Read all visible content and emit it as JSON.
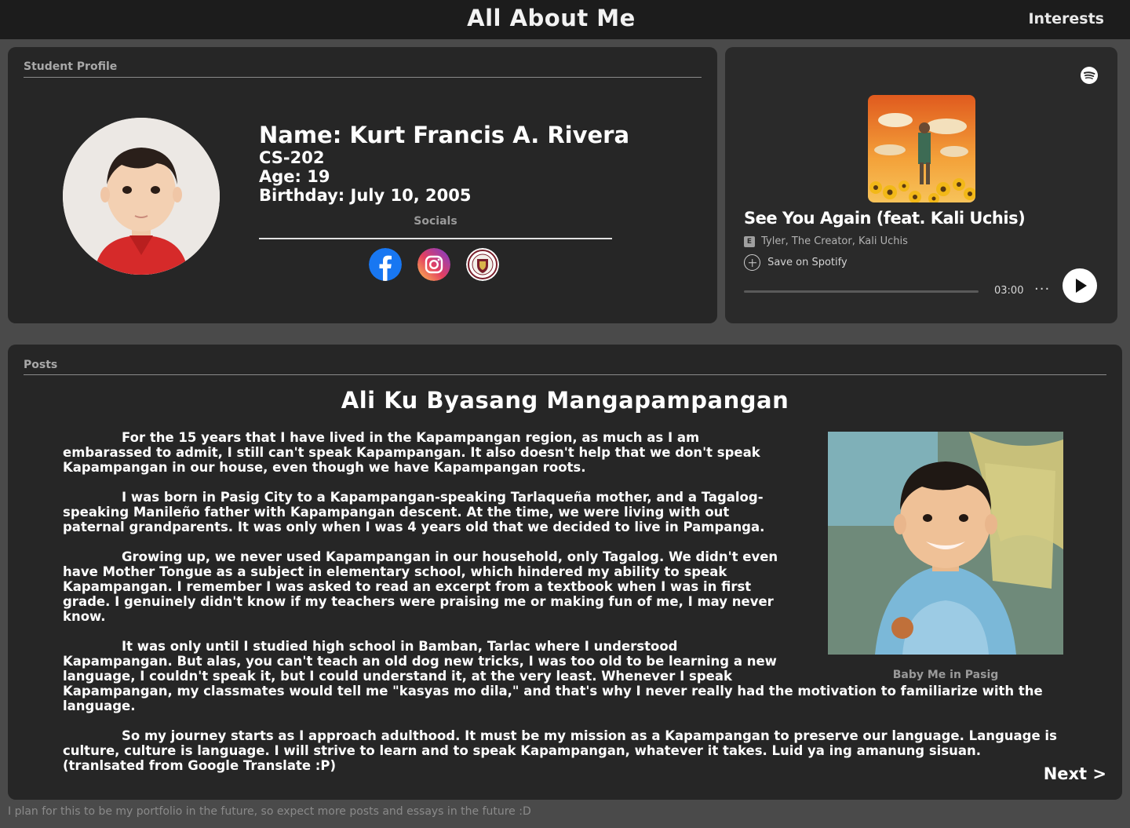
{
  "header": {
    "title": "All About Me",
    "nav_interests": "Interests"
  },
  "profile": {
    "section_label": "Student Profile",
    "name": "Name: Kurt Francis A. Rivera",
    "section": "CS-202",
    "age": "Age: 19",
    "birthday": "Birthday: July 10, 2005",
    "socials_label": "Socials",
    "socials": [
      {
        "icon": "facebook-icon",
        "color": "#1877f2"
      },
      {
        "icon": "instagram-icon",
        "color": "#d6249f"
      },
      {
        "icon": "school-seal-icon",
        "color": "#7a1f2b"
      }
    ]
  },
  "spotify": {
    "track_title": "See You Again (feat. Kali Uchis)",
    "explicit_badge": "E",
    "artists": "Tyler, The Creator, Kali Uchis",
    "save_label": "Save on Spotify",
    "duration": "03:00",
    "more_label": "···",
    "progress": 0,
    "accent": "#1db954"
  },
  "posts": {
    "section_label": "Posts",
    "title": "Ali Ku Byasang Mangapampangan",
    "paragraphs": [
      "For the 15 years that I have lived in the Kapampangan region, as much as I am embarassed to admit, I still can't speak Kapampangan. It also doesn't help that we don't speak Kapampangan in our house, even though we have Kapampangan roots.",
      "I was born in Pasig City to a Kapampangan-speaking Tarlaqueña mother, and a Tagalog-speaking Manileño father with Kapampangan descent. At the time, we were living with out paternal grandparents. It was only when I was 4 years old that we decided to live in Pampanga.",
      "Growing up, we never used Kapampangan in our household, only Tagalog. We didn't even have Mother Tongue as a subject in elementary school, which hindered my ability to speak Kapampangan. I remember I was asked to read an excerpt from a textbook when I was in first grade. I genuinely didn't know if my teachers were praising me or making fun of me, I may never know.",
      "It was only until I studied high school in Bamban, Tarlac where I understood Kapampangan. But alas, you can't teach an old dog new tricks, I was too old to be learning a new language, I couldn't speak it, but I could understand it, at the very least. Whenever I speak Kapampangan, my classmates would tell me \"kasyas mo dila,\" and that's why I never really had the motivation to familiarize with the language.",
      "So my journey starts as I approach adulthood. It must be my mission as a Kapampangan to preserve our language. Language is culture, culture is language. I will strive to learn and to speak Kapampangan, whatever it takes. Luid ya ing amanung sisuan. (tranlsated from Google Translate :P)"
    ],
    "photo_caption": "Baby Me in Pasig",
    "next_label": "Next >"
  },
  "footer": {
    "note": "I plan for this to be my portfolio in the future, so expect more posts and essays in the future :D"
  }
}
